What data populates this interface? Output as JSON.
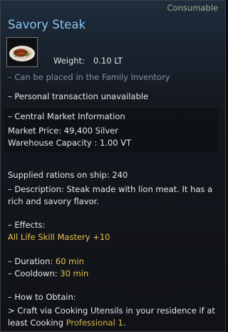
{
  "item": {
    "category": "Consumable",
    "name": "Savory Steak",
    "icon": "steak-plate-icon",
    "weight_label": "Weight:",
    "weight_value": "0.10 LT"
  },
  "notes": {
    "family_inventory": "– Can be placed in the Family Inventory",
    "personal_transaction": "– Personal transaction unavailable"
  },
  "market": {
    "header": "– Central Market Information",
    "price": "Market Price: 49,400 Silver",
    "warehouse": "Warehouse Capacity : 1.00 VT"
  },
  "supplied": "Supplied rations on ship: 240",
  "description": {
    "line1": "– Description: Steak made with lion meat. It has a",
    "line2": "rich and savory flavor."
  },
  "effects": {
    "label": "– Effects:",
    "value": "All Life Skill Mastery +10"
  },
  "timing": {
    "duration_label": "– Duration: ",
    "duration_value": "60 min",
    "cooldown_label": "– Cooldown: ",
    "cooldown_value": "30 min"
  },
  "obtain": {
    "label": "– How to Obtain:",
    "line1": " > Craft via Cooking Utensils in your residence if at",
    "line2_prefix": "least Cooking ",
    "line2_highlight": "Professional 1",
    "line2_suffix": "."
  },
  "colors": {
    "title": "#8cc4ee",
    "category": "#9bb28a",
    "effect_highlight": "#e7c04a",
    "muted_note": "#7e93aa"
  }
}
